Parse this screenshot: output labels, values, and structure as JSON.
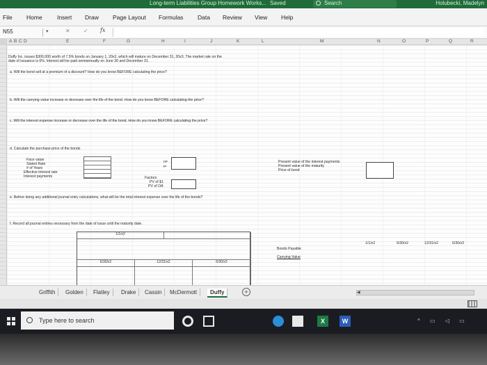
{
  "titlebar": {
    "title": "Long-term Liabilities Group Homework Works...",
    "saved": "Saved",
    "search_placeholder": "Search",
    "user": "Holubecki, Madelyn"
  },
  "ribbon": {
    "tabs": [
      "File",
      "Home",
      "Insert",
      "Draw",
      "Page Layout",
      "Formulas",
      "Data",
      "Review",
      "View",
      "Help"
    ]
  },
  "formula_bar": {
    "name_box": "N55",
    "cancel": "✕",
    "enter": "✓",
    "fx": "fx",
    "value": ""
  },
  "columns": [
    "A",
    "B",
    "C",
    "D",
    "E",
    "F",
    "G",
    "H",
    "I",
    "J",
    "K",
    "L",
    "M",
    "N",
    "O",
    "P",
    "Q",
    "R"
  ],
  "sheet": {
    "problem_line1": "Duffy Inc. issues $300,000 worth of 7.5% bonds on January 1, 20x2, which will mature on December 31, 20x3. The market rate on the",
    "problem_line2": "date of issuance is 6%. Interest will be paid semiannually on June 30 and December 31.",
    "q_a": "a. Will the bond sell at a premium of a discount? How do you know BEFORE calculating the price?",
    "q_b": "b. Will the carrying value increase or decrease over the life of the bond. How do you know BEFORE calculating the price?",
    "q_c": "c. Will the interest expense increase or decrease over the life of the bond. How do you know BEFORE calculating the price?",
    "q_d": "d. Calculate the purchase price of the bonds",
    "labels": [
      "Face value",
      "Stated Rate",
      "# of Years",
      "Effective interest rate",
      "Interest payments"
    ],
    "n_label": "n=",
    "i_label": "i=",
    "factors_title": "Factors",
    "factor_pv1": "PV of $1",
    "factor_pvoa": "PV of OA",
    "right_labels": [
      "Present value of the interest payments",
      "Present value of the maturity",
      "Price of bond"
    ],
    "q_e": "e. Before doing any additional journal entry calculations, what will be the total interest expense over the life of the bonds?",
    "q_f": "f. Record all journal entries necessary from the date of issue until the maturity date.",
    "je_date": "1/1/x2",
    "je_dates_bottom": [
      "6/30/x2",
      "12/31/x2",
      "6/30/x3"
    ],
    "bonds_payable": "Bonds Payable",
    "carrying_value": "Carrying Value",
    "timeline_dates": [
      "1/1/x2",
      "6/30/x2",
      "12/31/x2",
      "6/30/x3"
    ]
  },
  "sheet_tabs": [
    "Griffith",
    "Golden",
    "Flatley",
    "Drake",
    "Cassin",
    "McDermott",
    "Duffy"
  ],
  "active_sheet": "Duffy",
  "taskbar": {
    "search_placeholder": "Type here to search",
    "excel_glyph": "X",
    "word_glyph": "W",
    "tray": "^ ▭ ◁ ▭"
  }
}
